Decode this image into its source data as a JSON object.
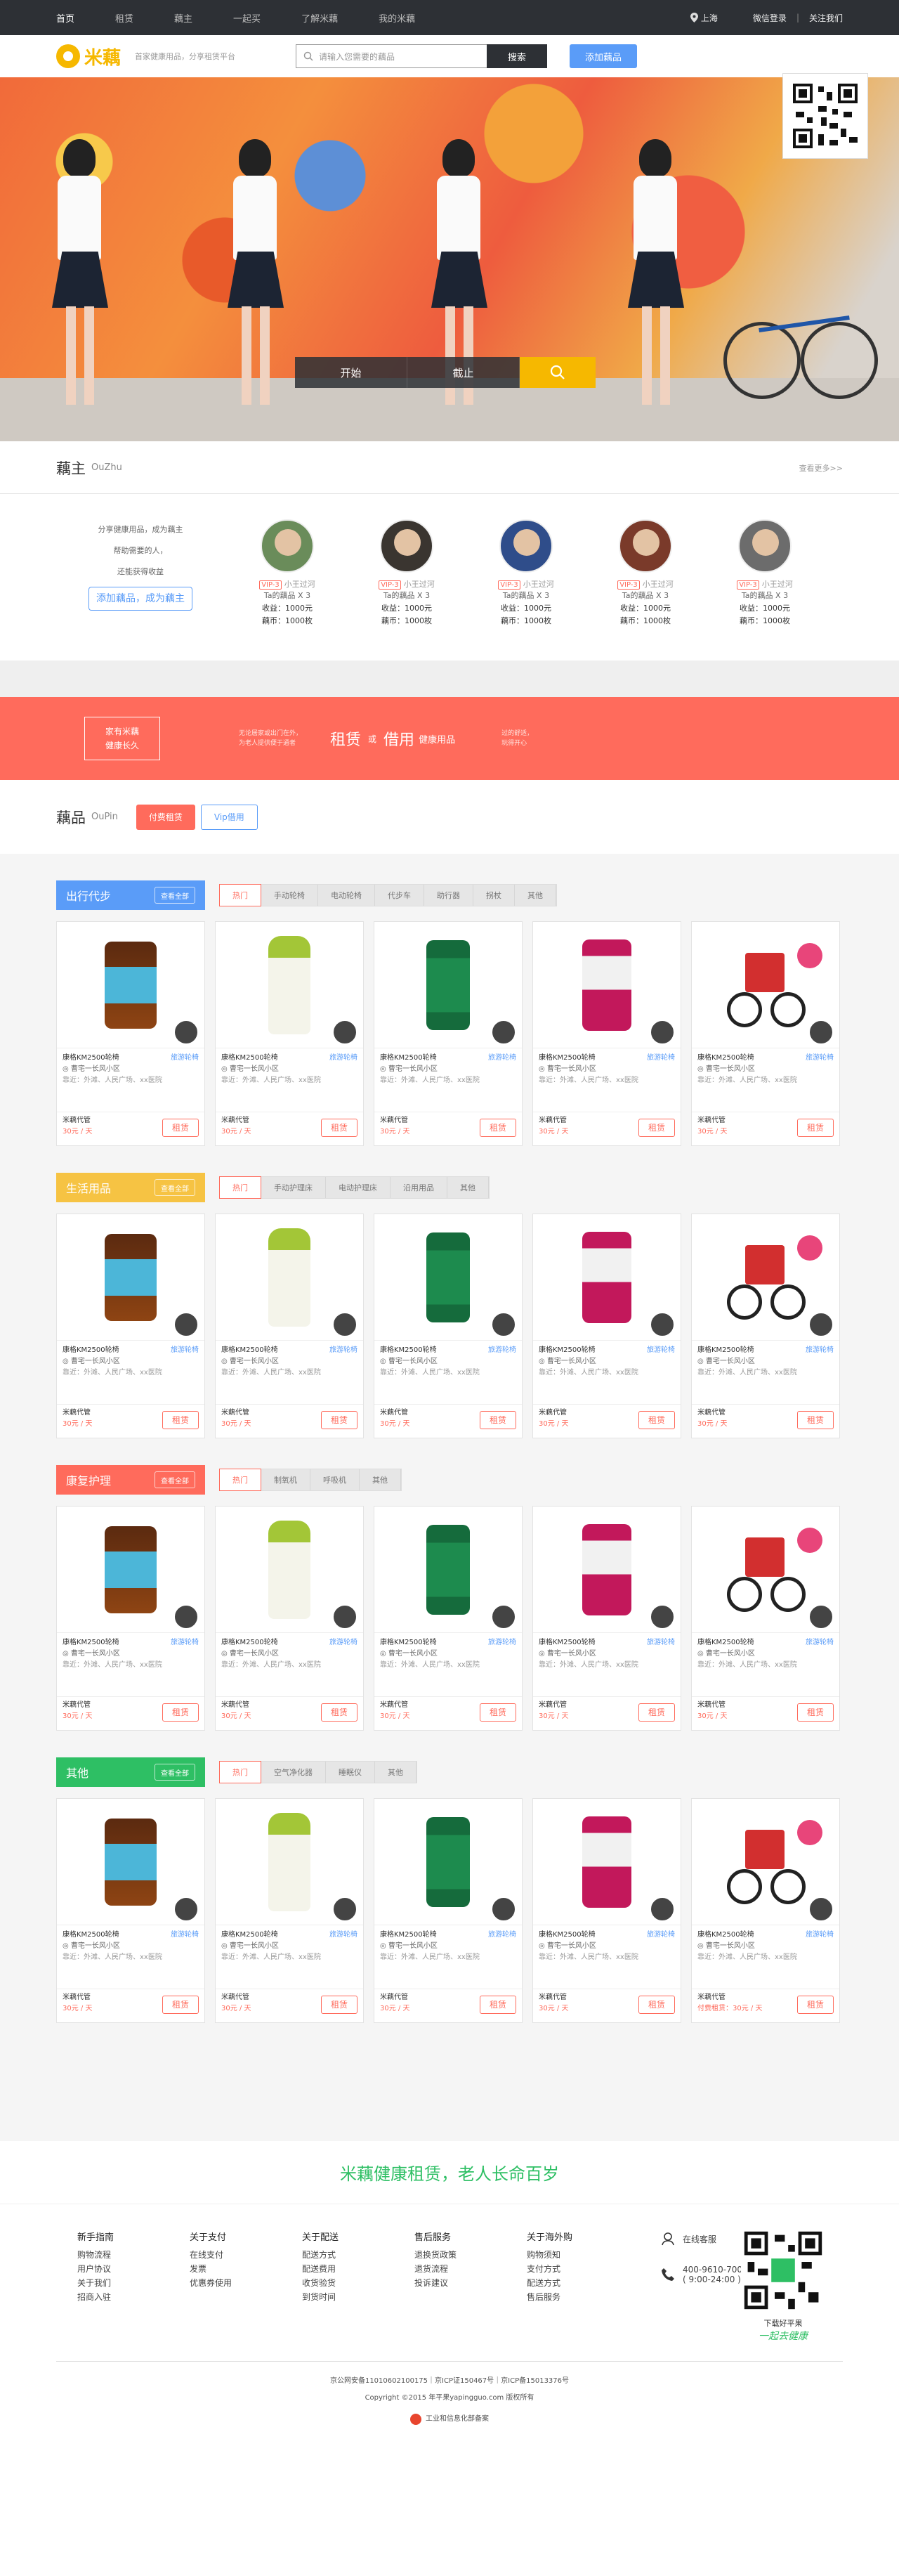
{
  "topnav": {
    "links": [
      "首页",
      "租赁",
      "藕主",
      "一起买",
      "了解米藕",
      "我的米藕"
    ],
    "location": "上海",
    "wechat_login": "微信登录",
    "follow_us": "关注我们"
  },
  "header": {
    "logo_text": "米藕",
    "slogan": "首家健康用品，分享租赁平台",
    "search_placeholder": "请输入您需要的藕品",
    "search_button": "搜索",
    "add_button": "添加藕品"
  },
  "banner": {
    "start_label": "开始",
    "end_label": "截止"
  },
  "owners_section": {
    "title": "藕主",
    "title_en": "OuZhu",
    "more": "查看更多>>",
    "intro_lines": [
      "分享健康用品，成为藕主",
      "帮助需要的人，",
      "还能获得收益"
    ],
    "become_button": "添加藕品，成为藕主",
    "owners": [
      {
        "vip": "VIP-3",
        "name": "小王过河",
        "items": "Ta的藕品 X 3",
        "income": "收益：1000元",
        "coins": "藕币：1000枚"
      },
      {
        "vip": "VIP-3",
        "name": "小王过河",
        "items": "Ta的藕品 X 3",
        "income": "收益：1000元",
        "coins": "藕币：1000枚"
      },
      {
        "vip": "VIP-3",
        "name": "小王过河",
        "items": "Ta的藕品 X 3",
        "income": "收益：1000元",
        "coins": "藕币：1000枚"
      },
      {
        "vip": "VIP-3",
        "name": "小王过河",
        "items": "Ta的藕品 X 3",
        "income": "收益：1000元",
        "coins": "藕币：1000枚"
      },
      {
        "vip": "VIP-3",
        "name": "小王过河",
        "items": "Ta的藕品 X 3",
        "income": "收益：1000元",
        "coins": "藕币：1000枚"
      }
    ]
  },
  "promo": {
    "box_line1": "家有米藕",
    "box_line2": "健康长久",
    "left_line1": "无论居家或出门在外，",
    "left_line2": "为老人提供便于通者",
    "rent": "租赁",
    "or": "或",
    "borrow": "借用",
    "tail": "健康用品",
    "right_line1": "过的舒适，",
    "right_line2": "玩得开心"
  },
  "products_section": {
    "title": "藕品",
    "title_en": "OuPin",
    "tab_paid": "付费租赁",
    "tab_vip": "Vip借用",
    "categories": [
      {
        "label": "出行代步",
        "color": "#5a9cf8",
        "view_all": "查看全部",
        "subtabs": [
          "热门",
          "手动轮椅",
          "电动轮椅",
          "代步车",
          "助行器",
          "拐杖",
          "其他"
        ]
      },
      {
        "label": "生活用品",
        "color": "#f6c343",
        "view_all": "查看全部",
        "subtabs": [
          "热门",
          "手动护理床",
          "电动护理床",
          "沿用用品",
          "其他"
        ]
      },
      {
        "label": "康复护理",
        "color": "#ff6b5c",
        "view_all": "查看全部",
        "subtabs": [
          "热门",
          "制氧机",
          "呼吸机",
          "其他"
        ]
      },
      {
        "label": "其他",
        "color": "#2ebf64",
        "view_all": "查看全部",
        "subtabs": [
          "热门",
          "空气净化器",
          "睡眠仪",
          "其他"
        ]
      }
    ],
    "card": {
      "name": "康格KM2500轮椅",
      "tag": "旅游轮椅",
      "address": "◎ 曹宅一长风小区",
      "nearby": "靠近：外滩、人民广场、xx医院",
      "source": "米藕代管",
      "price": "30元 / 天",
      "rent_button": "租赁"
    },
    "last_card_price": "付费租赁：30元 / 天"
  },
  "footer": {
    "tagline": "米藕健康租赁，老人长命百岁",
    "columns": [
      {
        "heading": "新手指南",
        "items": [
          "购物流程",
          "用户协议",
          "关于我们",
          "招商入驻"
        ]
      },
      {
        "heading": "关于支付",
        "items": [
          "在线支付",
          "发票",
          "优惠券使用"
        ]
      },
      {
        "heading": "关于配送",
        "items": [
          "配送方式",
          "配送费用",
          "收货验货",
          "到货时间"
        ]
      },
      {
        "heading": "售后服务",
        "items": [
          "退换货政策",
          "退货流程",
          "投诉建议"
        ]
      },
      {
        "heading": "关于海外购",
        "items": [
          "购物须知",
          "支付方式",
          "配送方式",
          "售后服务"
        ]
      }
    ],
    "online_service": "在线客服",
    "phone": "400-9610-700",
    "phone_hours": "( 9:00-24:00 )",
    "qr_caption": "下载好平果",
    "qr_sign": "一起去健康",
    "license_line": "京公网安备11010602100175｜京ICP证150467号｜京ICP备15013376号",
    "copyright": "Copyright ©2015 年平果yapingguo.com 版权所有",
    "badge": "工业和信息化部备案"
  }
}
